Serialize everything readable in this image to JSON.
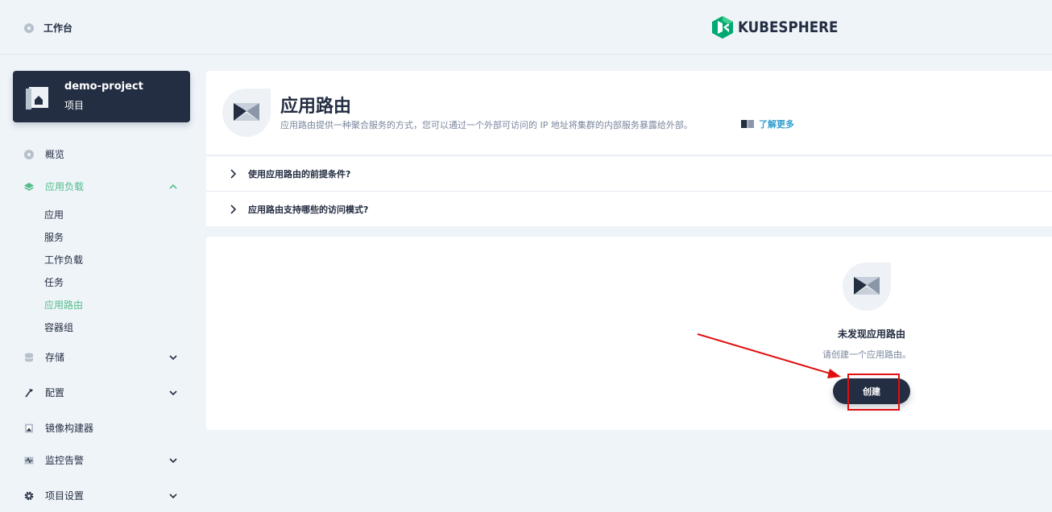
{
  "topbar": {
    "workbench_label": "工作台",
    "brand_name": "KUBESPHERE",
    "brand_color": "#00a971"
  },
  "project": {
    "name": "demo-project",
    "type_label": "项目"
  },
  "sidebar": {
    "overview": "概览",
    "app_workloads": "应用负载",
    "sub_items": [
      "应用",
      "服务",
      "工作负载",
      "任务",
      "应用路由",
      "容器组"
    ],
    "active_sub_item": "应用路由",
    "storage": "存储",
    "config": "配置",
    "image_builder": "镜像构建器",
    "monitoring": "监控告警",
    "project_settings": "项目设置",
    "accent_color": "#55bc8a"
  },
  "header": {
    "title": "应用路由",
    "description": "应用路由提供一种聚合服务的方式，您可以通过一个外部可访问的 IP 地址将集群的内部服务暴露给外部。",
    "learn_more": "了解更多"
  },
  "faq": [
    "使用应用路由的前提条件?",
    "应用路由支持哪些的访问模式?"
  ],
  "empty_state": {
    "title": "未发现应用路由",
    "description": "请创建一个应用路由。",
    "create_button": "创建"
  }
}
